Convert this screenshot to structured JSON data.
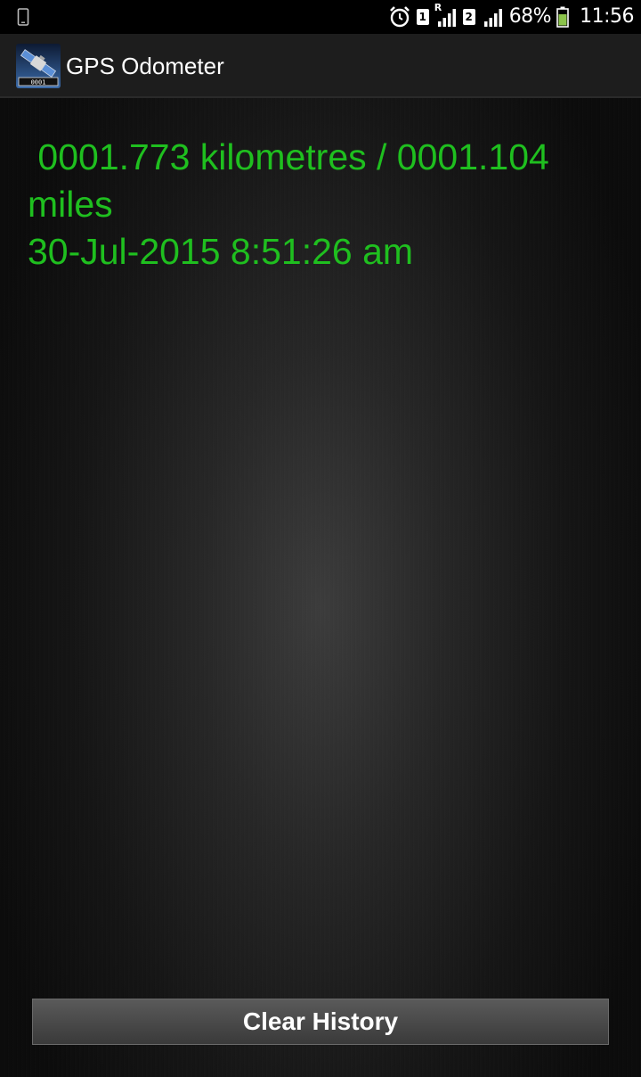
{
  "status_bar": {
    "sim1": "1",
    "sim2": "2",
    "roaming": "R",
    "battery": "68%",
    "time": "11:56",
    "icons": [
      "phone-icon",
      "alarm-icon",
      "signal-icon",
      "battery-icon"
    ]
  },
  "action_bar": {
    "title": "GPS Odometer",
    "icon": "satellite-app-icon"
  },
  "main": {
    "log_text": " 0001.773 kilometres / 0001.104 miles\n30-Jul-2015 8:51:26 am",
    "clear_button_label": "Clear History"
  },
  "colors": {
    "text_green": "#1fbf1f",
    "action_bar_bg": "#1d1d1d"
  }
}
